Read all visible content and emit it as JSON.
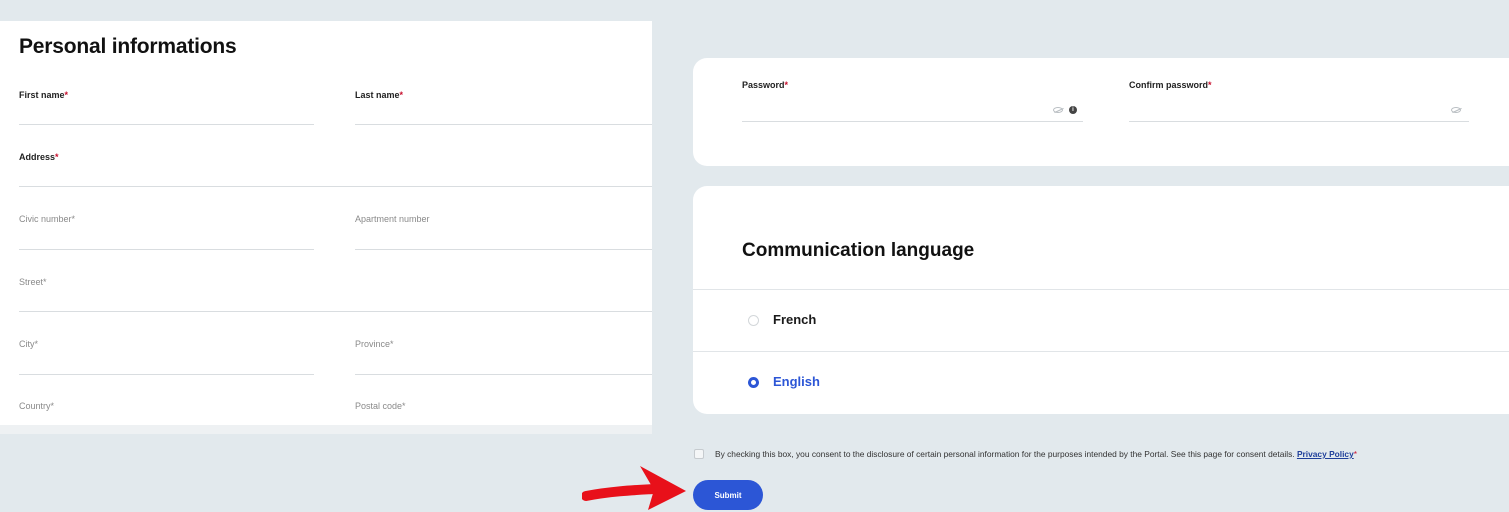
{
  "personal": {
    "title": "Personal informations",
    "fields": {
      "first_name": {
        "label": "First name",
        "req": "*",
        "value": ""
      },
      "last_name": {
        "label": "Last name",
        "req": "*",
        "value": ""
      },
      "address": {
        "label": "Address",
        "req": "*",
        "value": ""
      },
      "civic_number": {
        "label": "Civic number",
        "req": "*",
        "value": ""
      },
      "apartment_number": {
        "label": "Apartment number",
        "req": "",
        "value": ""
      },
      "street": {
        "label": "Street",
        "req": "*",
        "value": ""
      },
      "city": {
        "label": "City",
        "req": "*",
        "value": ""
      },
      "province": {
        "label": "Province",
        "req": "*",
        "value": ""
      },
      "country": {
        "label": "Country",
        "req": "*",
        "value": ""
      },
      "postal_code": {
        "label": "Postal code",
        "req": "*",
        "value": ""
      }
    }
  },
  "password": {
    "label": "Password",
    "confirm_label": "Confirm password",
    "req": "*",
    "info_glyph": "i",
    "icons": [
      "eye-off-icon",
      "info-icon"
    ]
  },
  "language": {
    "title": "Communication language",
    "options": [
      {
        "label": "French",
        "selected": false
      },
      {
        "label": "English",
        "selected": true
      }
    ]
  },
  "consent": {
    "text": "By checking this box, you consent to the disclosure of certain personal information for the purposes intended by the Portal. See this page for consent details.",
    "link": "Privacy Policy",
    "req": "*",
    "checked": false
  },
  "submit": {
    "label": "Submit"
  },
  "colors": {
    "accent": "#2c56d6",
    "required": "#c8102e",
    "background": "#e2e9ed",
    "annotation_arrow": "#e8101a"
  }
}
